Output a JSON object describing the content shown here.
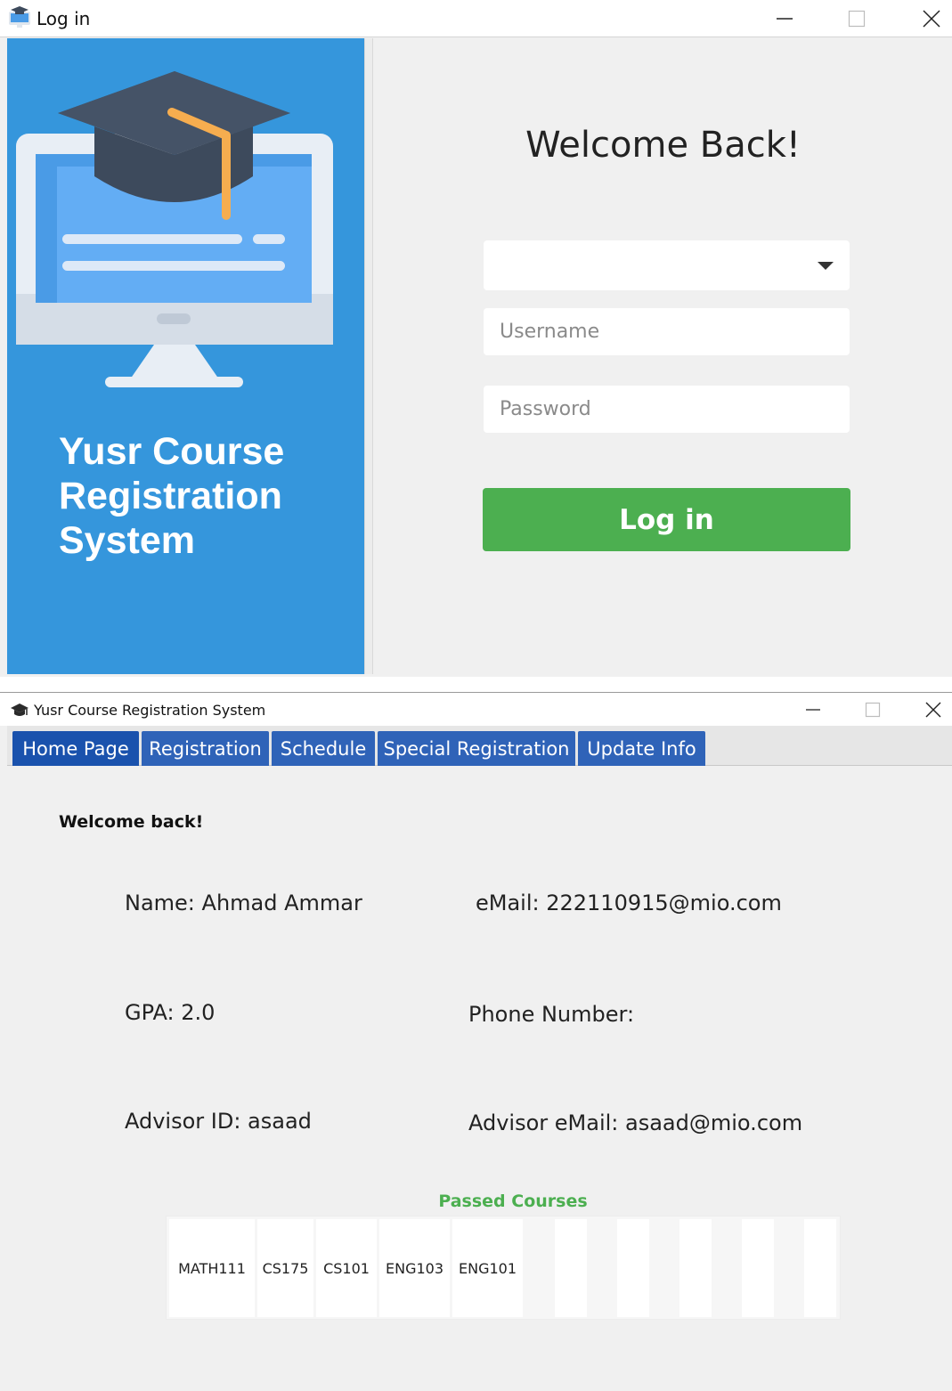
{
  "login_window": {
    "title": "Log in",
    "brand_title": "Yusr Course Registration System",
    "welcome": "Welcome Back!",
    "role_select_value": "",
    "username_placeholder": "Username",
    "password_placeholder": "Password",
    "login_button": "Log in"
  },
  "main_window": {
    "title": "Yusr Course Registration System",
    "tabs": [
      {
        "label": "Home Page"
      },
      {
        "label": "Registration"
      },
      {
        "label": "Schedule"
      },
      {
        "label": "Special Registration"
      },
      {
        "label": "Update Info"
      }
    ],
    "active_tab": "Home Page",
    "greeting": "Welcome back!",
    "name": "Name: Ahmad Ammar",
    "email": "eMail: 222110915@mio.com",
    "gpa": "GPA: 2.0",
    "phone": "Phone Number:",
    "advisor_id": "Advisor ID: asaad",
    "advisor_email": "Advisor eMail: asaad@mio.com",
    "passed_courses_title": "Passed Courses",
    "passed_courses": [
      "MATH111",
      "CS175",
      "CS101",
      "ENG103",
      "ENG101",
      "",
      "",
      "",
      "",
      ""
    ]
  },
  "colors": {
    "brand_blue": "#3596dc",
    "login_green": "#4caf50",
    "tab_blue": "#2f63b8",
    "passed_green": "#4caf50"
  },
  "icons": {
    "login_app": "monitor-graduation-cap-icon",
    "main_app": "graduation-cap-icon",
    "minimize": "minimize-icon",
    "maximize": "maximize-icon",
    "close": "close-icon",
    "dropdown": "caret-down-icon"
  }
}
